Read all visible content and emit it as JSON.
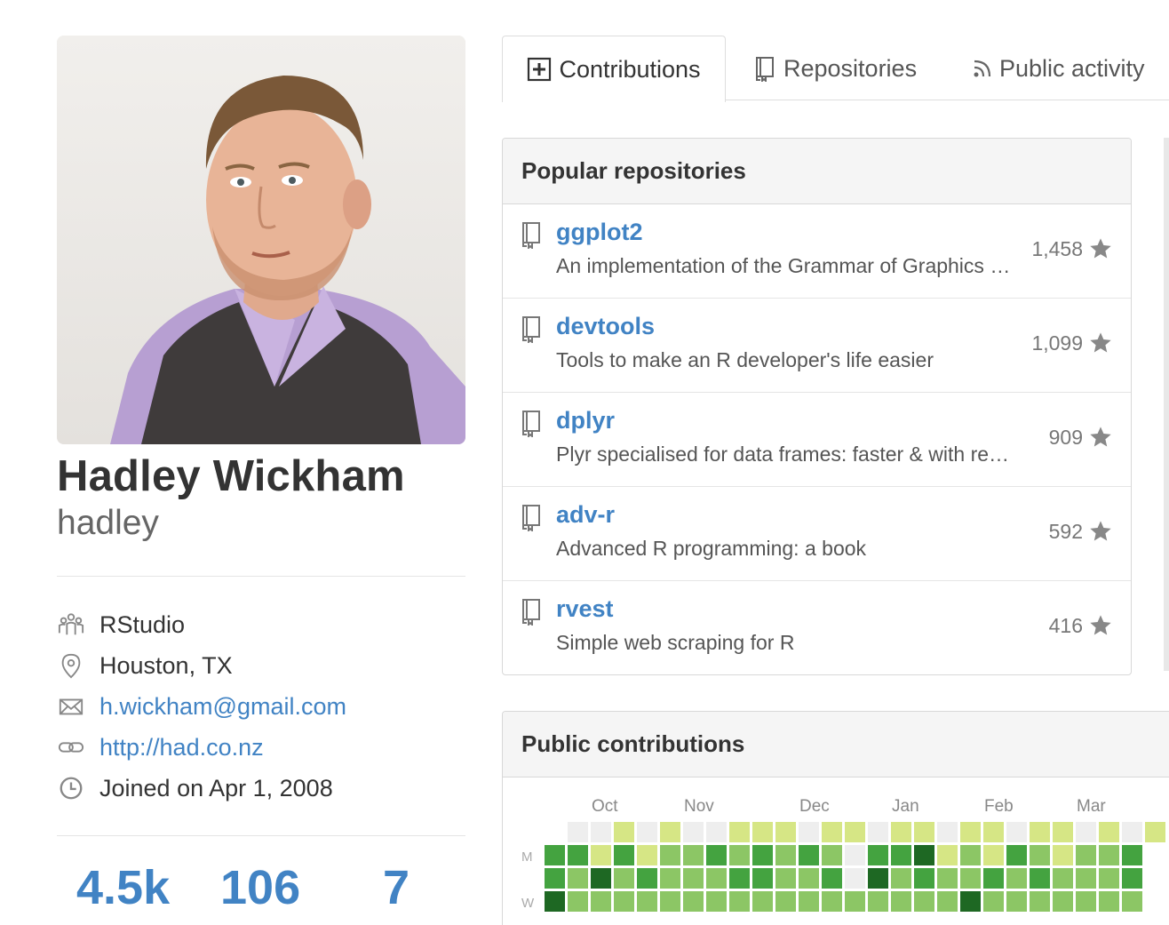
{
  "profile": {
    "full_name": "Hadley Wickham",
    "username": "hadley",
    "organization": "RStudio",
    "location": "Houston, TX",
    "email": "h.wickham@gmail.com",
    "website": "http://had.co.nz",
    "joined": "Joined on Apr 1, 2008"
  },
  "stats": {
    "followers": "4.5k",
    "starred": "106",
    "following": "7"
  },
  "tabs": [
    {
      "label": "Contributions",
      "icon": "plus-square-icon",
      "selected": true
    },
    {
      "label": "Repositories",
      "icon": "repo-book-icon",
      "selected": false
    },
    {
      "label": "Public activity",
      "icon": "rss-icon",
      "selected": false
    }
  ],
  "popular_repos": {
    "title": "Popular repositories",
    "items": [
      {
        "name": "ggplot2",
        "description": "An implementation of the Grammar of Graphics in R",
        "stars": "1,458"
      },
      {
        "name": "devtools",
        "description": "Tools to make an R developer's life easier",
        "stars": "1,099"
      },
      {
        "name": "dplyr",
        "description": "Plyr specialised for data frames: faster & with remote datastores",
        "stars": "909"
      },
      {
        "name": "adv-r",
        "description": "Advanced R programming: a book",
        "stars": "592"
      },
      {
        "name": "rvest",
        "description": "Simple web scraping for R",
        "stars": "416"
      }
    ]
  },
  "contributions": {
    "title": "Public contributions",
    "months": [
      "Oct",
      "Nov",
      "Dec",
      "Jan",
      "Feb",
      "Mar"
    ],
    "day_labels": [
      "M",
      "W"
    ],
    "colors": [
      "#eeeeee",
      "#d6e685",
      "#8cc665",
      "#44a340",
      "#1e6823"
    ],
    "levels": [
      [
        0,
        0,
        1,
        0,
        1,
        0,
        0,
        1,
        1,
        1,
        0,
        1,
        1,
        0,
        1,
        1,
        0,
        1,
        1,
        0,
        1,
        1,
        0,
        1,
        0,
        1
      ],
      [
        3,
        3,
        1,
        3,
        1,
        2,
        2,
        3,
        2,
        3,
        2,
        3,
        2,
        0,
        3,
        3,
        4,
        1,
        2,
        1,
        3,
        2,
        1,
        2,
        2,
        3
      ],
      [
        3,
        2,
        4,
        2,
        3,
        2,
        2,
        2,
        3,
        3,
        2,
        2,
        3,
        0,
        4,
        2,
        3,
        2,
        2,
        3,
        2,
        3,
        2,
        2,
        2,
        3
      ],
      [
        4,
        2,
        2,
        2,
        2,
        2,
        2,
        2,
        2,
        2,
        2,
        2,
        2,
        2,
        2,
        2,
        2,
        2,
        4,
        2,
        2,
        2,
        2,
        2,
        2,
        2
      ]
    ]
  }
}
